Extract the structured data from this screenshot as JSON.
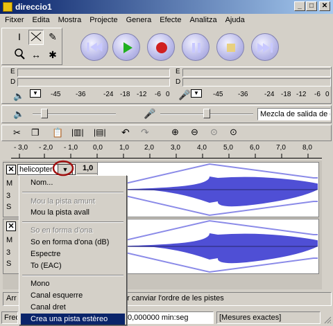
{
  "window": {
    "title": "direccio1"
  },
  "menu": [
    "Fitxer",
    "Edita",
    "Mostra",
    "Projecte",
    "Genera",
    "Efecte",
    "Analitza",
    "Ajuda"
  ],
  "meters": {
    "left_label": "E",
    "right_label": "D",
    "scale": [
      "-45",
      "-36",
      "-24",
      "-18",
      "-12",
      "-6",
      "0"
    ]
  },
  "mixer": {
    "input_select": "Mezcla de salida de o"
  },
  "ruler": [
    "- 3,0",
    "- 2,0",
    "- 1,0",
    "0,0",
    "1,0",
    "2,0",
    "3,0",
    "4,0",
    "5,0",
    "6,0",
    "7,0",
    "8,0"
  ],
  "track": {
    "name": "helicopter",
    "label_prefix": "M",
    "sub_prefix": "3",
    "s_prefix": "S",
    "ruler_value": "1,0",
    "close": "✕"
  },
  "popup": {
    "items": [
      {
        "label": "Nom...",
        "disabled": false
      },
      {
        "label": "Mou la pista amunt",
        "disabled": true
      },
      {
        "label": "Mou la pista avall",
        "disabled": false
      },
      {
        "label": "So en forma d'ona",
        "disabled": true
      },
      {
        "label": "So en forma d'ona (dB)",
        "disabled": false
      },
      {
        "label": "Espectre",
        "disabled": false
      },
      {
        "label": "To (EAC)",
        "disabled": false
      },
      {
        "label": "Mono",
        "disabled": false
      },
      {
        "label": "Canal esquerre",
        "disabled": false
      },
      {
        "label": "Canal dret",
        "disabled": false
      },
      {
        "label": "Crea una pista estèreo",
        "disabled": false,
        "highlighted": true
      }
    ]
  },
  "status": {
    "left_text": "Arr",
    "hint": "er canviar l'ordre de les pistes",
    "freq_prefix": "Freq",
    "selection": "0,000000 min:seg",
    "snap": "[Mesures exactes]"
  },
  "colors": {
    "waveform": "#3c3cd0",
    "envelope": "#8a8ae8",
    "highlight": "#0a246a",
    "circle": "#a01010"
  }
}
